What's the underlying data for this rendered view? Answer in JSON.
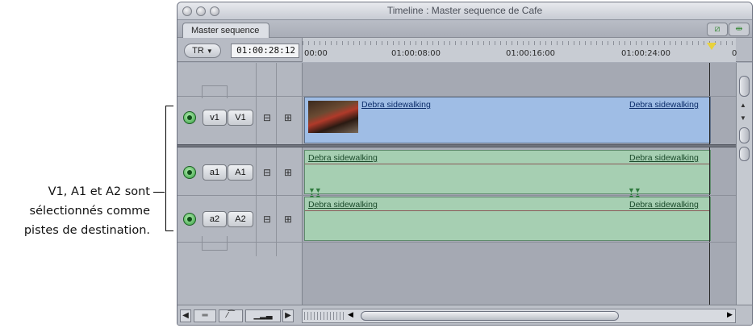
{
  "callout": {
    "line1": "V1, A1 et A2 sont",
    "line2": "sélectionnés comme",
    "line3": "pistes de destination."
  },
  "window": {
    "title": "Timeline : Master sequence de Cafe",
    "tab_label": "Master sequence"
  },
  "header": {
    "tr_label": "TR",
    "timecode": "01:00:28:12",
    "ruler_labels": [
      "00:00",
      "01:00:08:00",
      "01:00:16:00",
      "01:00:24:00",
      "0"
    ]
  },
  "tracks": [
    {
      "source": "v1",
      "dest": "V1",
      "type": "video",
      "clip_start": "Debra sidewalking",
      "clip_end": "Debra sidewalking"
    },
    {
      "source": "a1",
      "dest": "A1",
      "type": "audio",
      "clip_start": "Debra sidewalking",
      "clip_end": "Debra sidewalking"
    },
    {
      "source": "a2",
      "dest": "A2",
      "type": "audio",
      "clip_start": "Debra sidewalking",
      "clip_end": "Debra sidewalking"
    }
  ],
  "colors": {
    "video_clip": "#9fbde5",
    "audio_clip": "#a6cfb2",
    "track_toggle": "#2e9b3a",
    "playhead_marker": "#e8d23c"
  },
  "icons": {
    "lock": "lock-icon",
    "autoselect": "auto-select-icon",
    "speaker": "speaker-icon"
  }
}
